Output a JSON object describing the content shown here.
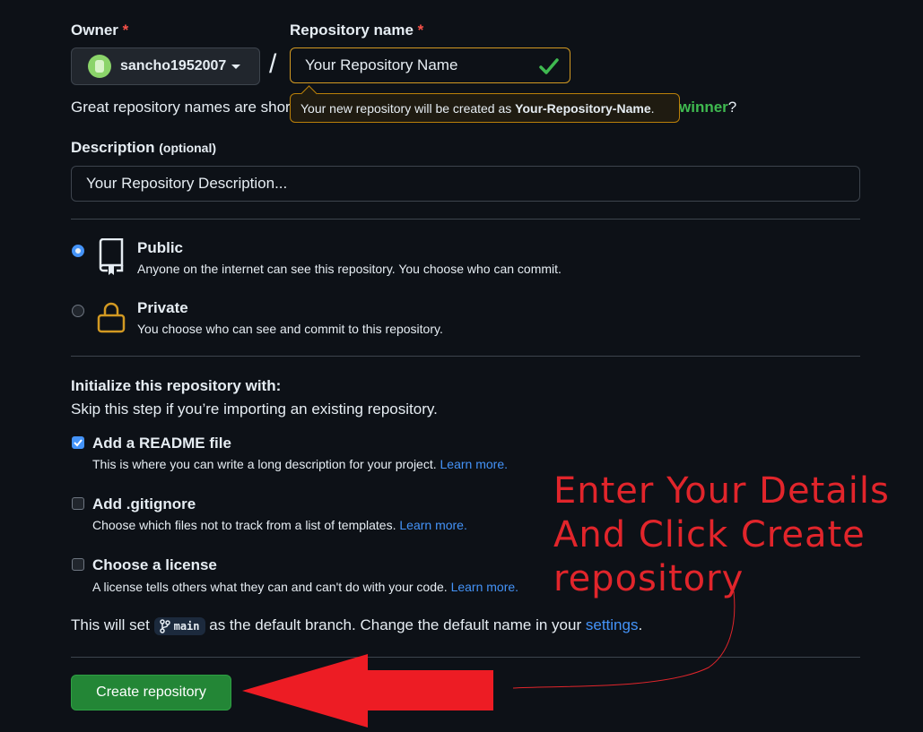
{
  "owner": {
    "label": "Owner",
    "required_mark": "*",
    "username": "sancho1952007"
  },
  "separator": "/",
  "repo_name": {
    "label": "Repository name",
    "required_mark": "*",
    "value": "Your Repository Name"
  },
  "hint": {
    "prefix": "Great repository names are shor",
    "suffix_highlight": "winner",
    "suffix_end": "?"
  },
  "tooltip": {
    "prefix": "Your new repository will be created as ",
    "name": "Your-Repository-Name",
    "suffix": "."
  },
  "description": {
    "label": "Description",
    "optional": "(optional)",
    "value": "Your Repository Description..."
  },
  "visibility": [
    {
      "title": "Public",
      "desc": "Anyone on the internet can see this repository. You choose who can commit.",
      "selected": true
    },
    {
      "title": "Private",
      "desc": "You choose who can see and commit to this repository.",
      "selected": false
    }
  ],
  "init": {
    "heading": "Initialize this repository with:",
    "subheading": "Skip this step if you’re importing an existing repository.",
    "options": [
      {
        "title": "Add a README file",
        "desc": "This is where you can write a long description for your project.",
        "link": "Learn more.",
        "checked": true
      },
      {
        "title": "Add .gitignore",
        "desc": "Choose which files not to track from a list of templates.",
        "link": "Learn more.",
        "checked": false
      },
      {
        "title": "Choose a license",
        "desc": "A license tells others what they can and can't do with your code.",
        "link": "Learn more.",
        "checked": false
      }
    ]
  },
  "branch_note": {
    "prefix": "This will set",
    "branch": "main",
    "middle": "as the default branch. Change the default name in your",
    "link": "settings",
    "suffix": "."
  },
  "create_button": "Create repository",
  "annotation": {
    "line1": "Enter Your Details",
    "line2": "And Click Create",
    "line3": "repository"
  },
  "colors": {
    "accent_blue": "#4493f8",
    "success_green": "#238636",
    "annotation_red": "#e1252b",
    "warning_border": "#d29922"
  }
}
